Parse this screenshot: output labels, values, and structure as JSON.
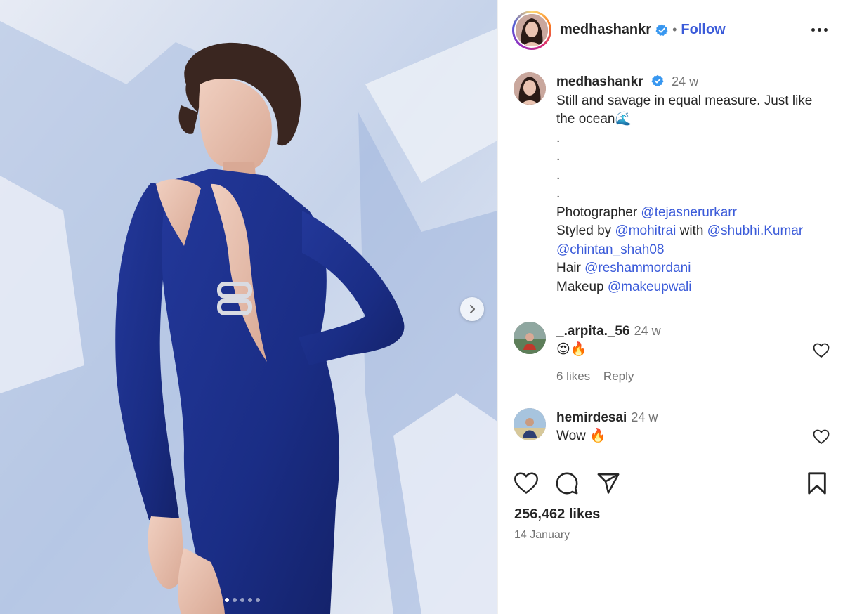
{
  "post": {
    "username": "medhashankr",
    "follow_label": "Follow",
    "separator": "•"
  },
  "caption": {
    "username": "medhashankr",
    "time": "24 w",
    "text_line1": "Still and savage in equal measure. Just like",
    "text_line2": "the ocean🌊",
    "dots": [
      ".",
      ".",
      ".",
      "."
    ],
    "credits": [
      {
        "label": "Photographer ",
        "mentions": [
          "@tejasnerurkarr"
        ]
      },
      {
        "label": "Styled by ",
        "mentions": [
          "@mohitrai",
          "@shubhi.Kumar"
        ],
        "joiner": " with "
      },
      {
        "label": "",
        "mentions": [
          "@chintan_shah08"
        ]
      },
      {
        "label": "Hair ",
        "mentions": [
          "@reshammordani"
        ]
      },
      {
        "label": "Makeup ",
        "mentions": [
          "@makeupwali"
        ]
      }
    ]
  },
  "comments": [
    {
      "username": "_.arpita._56",
      "time": "24 w",
      "text": "😍🔥",
      "likes": "6 likes",
      "reply": "Reply"
    },
    {
      "username": "hemirdesai",
      "time": "24 w",
      "text": "Wow 🔥"
    }
  ],
  "footer": {
    "likes": "256,462 likes",
    "date": "14 January"
  },
  "carousel": {
    "count": 5,
    "active_index": 0
  },
  "colors": {
    "link": "#3b5bd9",
    "verified": "#3897f0",
    "dress": "#1b2f8a"
  },
  "icons": [
    "verified-badge-icon",
    "more-options-icon",
    "heart-icon",
    "comment-icon",
    "share-icon",
    "bookmark-icon",
    "chevron-right-icon"
  ]
}
